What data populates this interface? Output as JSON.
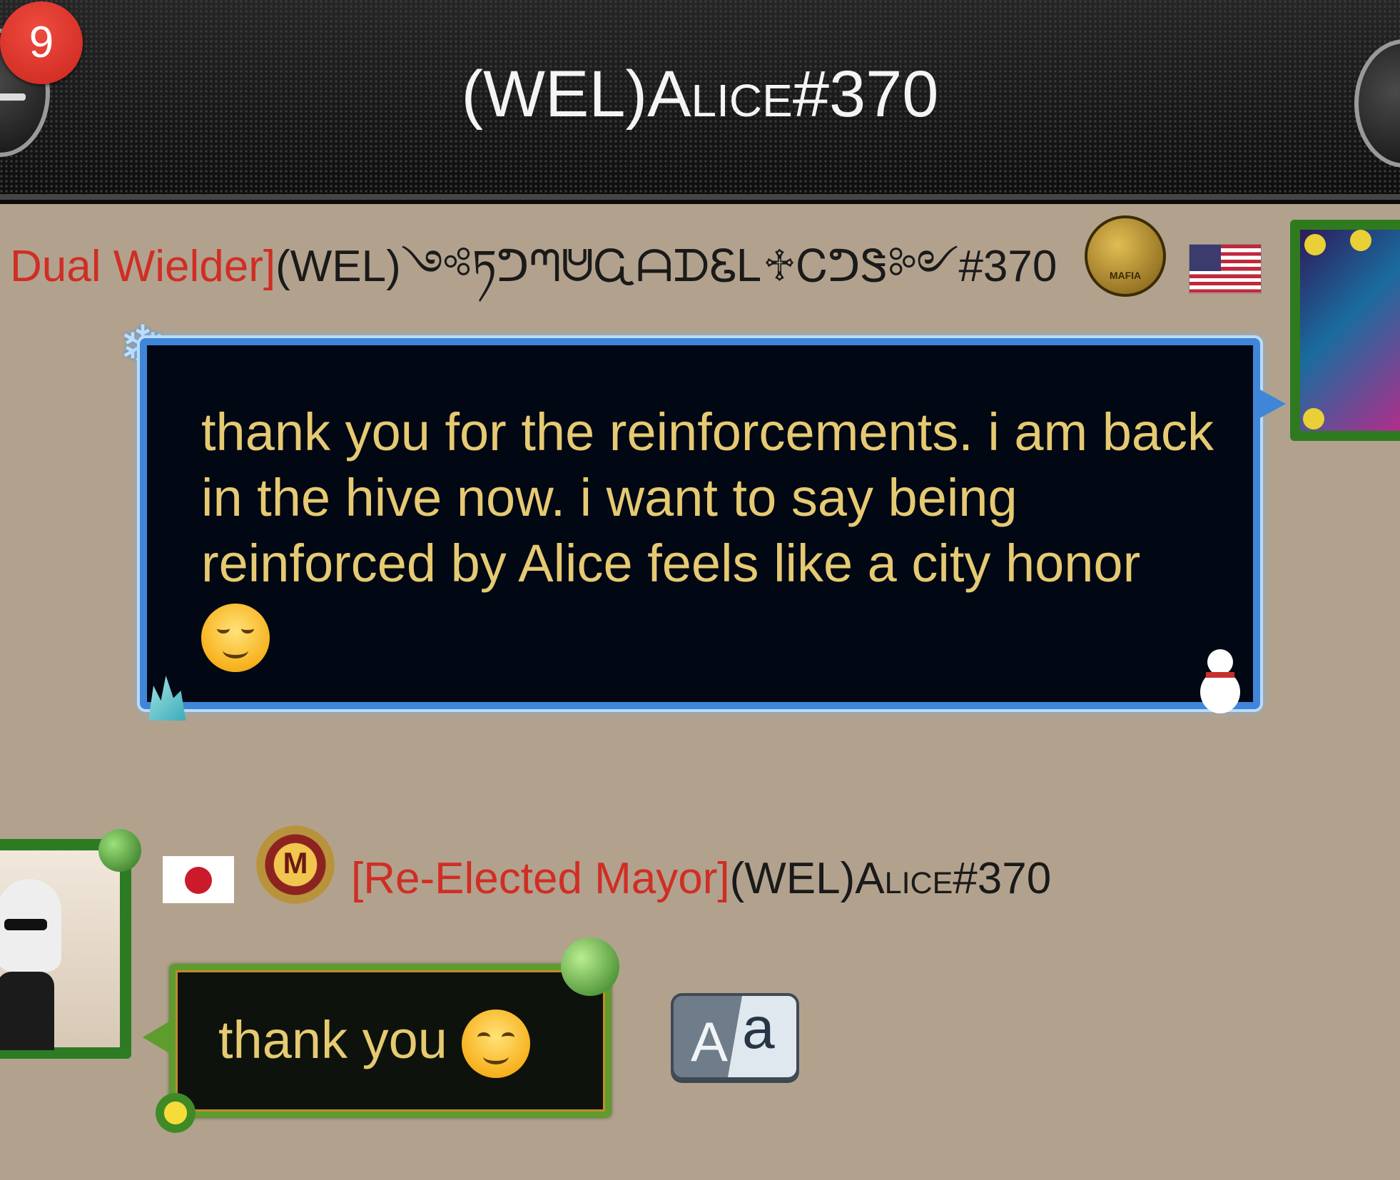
{
  "header": {
    "title_prefix": "(WEL)",
    "title_name": "Alice",
    "title_suffix": "#370",
    "unread_badge": "9",
    "back_icon": "back-icon",
    "menu_icon": "menu-icon"
  },
  "messages": [
    {
      "role": "Dual Wielder]",
      "sender": "(WEL)༺ཏᕤᘉᕰᏩᗩᗪᏋᏞ♱ᏟᕤᏕ༻#370",
      "flag": "us-flag-icon",
      "badge": "MAFIA",
      "text": "thank you for the reinforcements. i am back in the hive now. i want to say being reinforced by Alice feels like a city honor",
      "emoji": "relieved-face-emoji"
    },
    {
      "role": "[Re-Elected Mayor]",
      "sender_prefix": "(WEL)",
      "sender_name": "Alice",
      "sender_suffix": "#370",
      "flag": "japan-flag-icon",
      "badge_letter": "M",
      "text": "thank you",
      "emoji": "smiling-face-emoji"
    }
  ],
  "translate_button": {
    "left_glyph": "A",
    "right_glyph": "a"
  },
  "colors": {
    "background": "#b2a28d",
    "message_text": "#e6ca72",
    "role_text": "#cf2e25",
    "bubble_border_blue": "#3f86d8",
    "bubble_border_green": "#5e9c2d"
  }
}
